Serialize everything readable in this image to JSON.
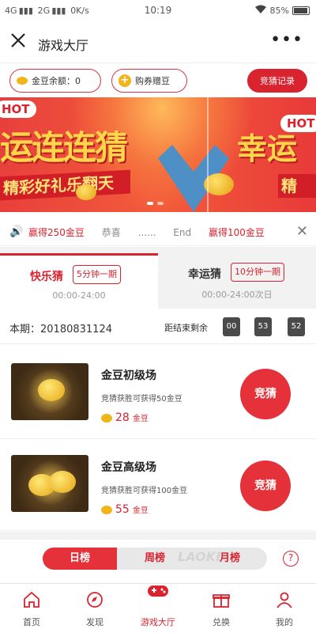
{
  "status_bar": {
    "network": "4G",
    "network2": "2G",
    "speed": "0K/s",
    "time": "10:19",
    "battery": "85%"
  },
  "title_bar": {
    "title": "游戏大厅",
    "more": "•••"
  },
  "actions": {
    "balance_label": "金豆余额：0",
    "buy_label": "购券赠豆",
    "records_label": "竞猜记录"
  },
  "banner": {
    "hot": "HOT",
    "headline_left": "运连连猜",
    "sub_left": "精彩好礼乐翻天",
    "hot_right": "HOT",
    "headline_right": "幸运",
    "sub_right": "精"
  },
  "ticker": {
    "items": [
      "赢得250金豆",
      "恭喜",
      "......",
      "End",
      "赢得100金豆"
    ]
  },
  "tabs": [
    {
      "name": "快乐猜",
      "period": "5分钟一期",
      "hours": "00:00-24:00"
    },
    {
      "name": "幸运猜",
      "period": "10分钟一期",
      "hours": "00:00-24:00次日"
    }
  ],
  "issue": {
    "label": "本期：20180831124",
    "countdown_label": "距结束剩余",
    "countdown": [
      "00",
      "53",
      "52"
    ]
  },
  "venues": [
    {
      "name": "金豆初级场",
      "desc": "竞猜获胜可获得50金豆",
      "price": "28",
      "unit": "金豆",
      "button": "竞猜"
    },
    {
      "name": "金豆高级场",
      "desc": "竞猜获胜可获得100金豆",
      "price": "55",
      "unit": "金豆",
      "button": "竞猜"
    }
  ],
  "ranking": {
    "tabs": [
      "日榜",
      "周榜",
      "月榜"
    ],
    "help": "?",
    "watermark": "LAOKE"
  },
  "tabbar": [
    {
      "label": "首页",
      "icon": "home-icon"
    },
    {
      "label": "发现",
      "icon": "discover-icon"
    },
    {
      "label": "游戏大厅",
      "icon": "gamepad-icon"
    },
    {
      "label": "兑换",
      "icon": "gift-icon"
    },
    {
      "label": "我的",
      "icon": "user-icon"
    }
  ],
  "colors": {
    "accent": "#d9232f",
    "gold": "#f0b51b"
  }
}
